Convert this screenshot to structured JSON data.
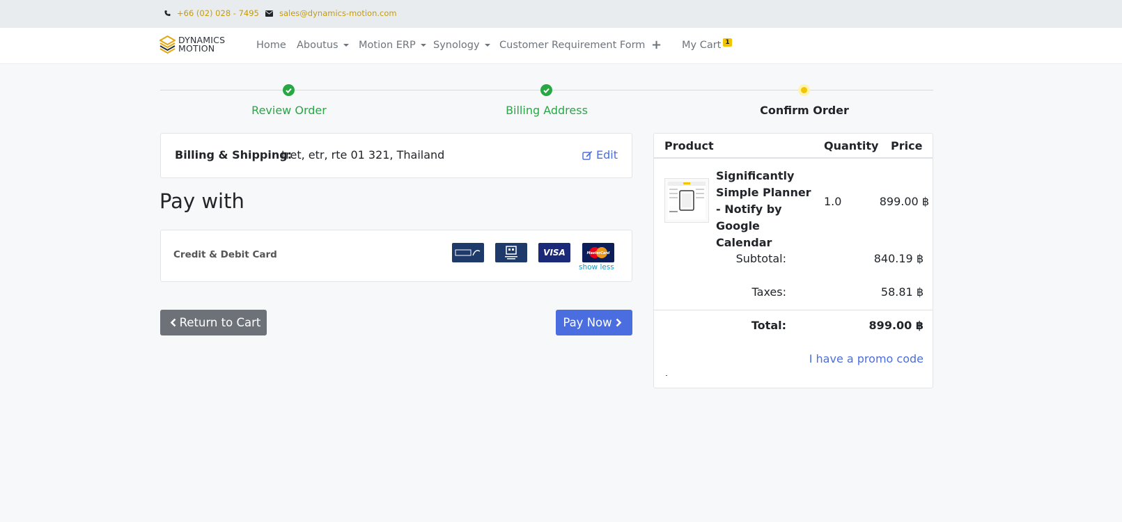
{
  "topbar": {
    "phone": "+66 (02) 028 - 7495",
    "email": "sales@dynamics-motion.com"
  },
  "brand": {
    "line1": "DYNAMICS",
    "line2": "MOTION"
  },
  "nav": {
    "home": "Home",
    "aboutus": "Aboutus",
    "motion_erp": "Motion ERP",
    "synology": "Synology",
    "crf": "Customer Requirement Form",
    "plus": "+",
    "cart": "My Cart",
    "cart_count": "1"
  },
  "steps": [
    {
      "label": "Review Order",
      "state": "done"
    },
    {
      "label": "Billing Address",
      "state": "done"
    },
    {
      "label": "Confirm Order",
      "state": "current"
    }
  ],
  "billing": {
    "label": "Billing & Shipping:",
    "address": "tret, etr, rte 01 321, Thailand",
    "edit": "Edit"
  },
  "pay_with": "Pay with",
  "payment": {
    "method": "Credit & Debit Card",
    "icons": [
      "promptpay-icon",
      "thai-qr-icon",
      "visa-icon",
      "mastercard-icon"
    ],
    "visa": "VISA",
    "mastercard": "MasterCard",
    "show_less": "show less"
  },
  "buttons": {
    "return": "Return to Cart",
    "pay": "Pay Now"
  },
  "summary": {
    "headers": {
      "product": "Product",
      "quantity": "Quantity",
      "price": "Price"
    },
    "item": {
      "name": "Significantly Simple Planner - Notify by Google Calendar",
      "quantity": "1.0",
      "price": "899.00 ฿"
    },
    "subtotal_label": "Subtotal:",
    "subtotal": "840.19 ฿",
    "taxes_label": "Taxes:",
    "taxes": "58.81 ฿",
    "total_label": "Total:",
    "total": "899.00 ฿",
    "promo": "I have a promo code"
  },
  "colors": {
    "accent": "#4a6ee0",
    "success": "#28a745",
    "topbar_text": "#c59b08",
    "badge": "#f3c500"
  }
}
